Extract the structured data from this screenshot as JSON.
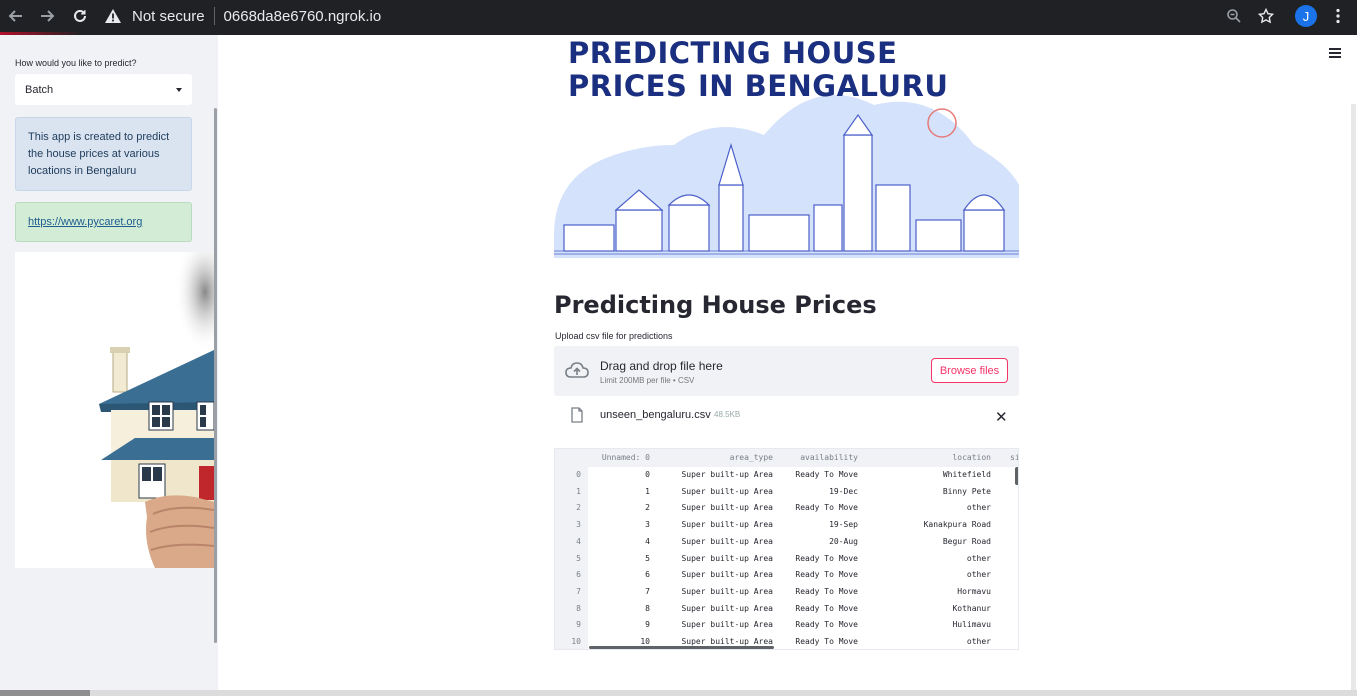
{
  "browser": {
    "security_label": "Not secure",
    "url": "0668da8e6760.ngrok.io",
    "profile_initial": "J"
  },
  "sidebar": {
    "predict_label": "How would you like to predict?",
    "predict_value": "Batch",
    "info_text": "This app is created to predict the house prices at various locations in Bengaluru",
    "link_text": "https://www.pycaret.org"
  },
  "banner": {
    "line1": "PREDICTING HOUSE",
    "line2": "PRICES IN BENGALURU"
  },
  "main": {
    "title": "Predicting House Prices",
    "upload_label": "Upload csv file for predictions",
    "dropzone_title": "Drag and drop file here",
    "dropzone_sub": "Limit 200MB per file • CSV",
    "browse_label": "Browse files",
    "file_name": "unseen_bengaluru.csv",
    "file_size": "48.5KB"
  },
  "table": {
    "columns": [
      "Unnamed: 0",
      "area_type",
      "availability",
      "location",
      "si"
    ],
    "rows": [
      [
        "0",
        "0",
        "Super built-up Area",
        "Ready To Move",
        "Whitefield"
      ],
      [
        "1",
        "1",
        "Super built-up Area",
        "19-Dec",
        "Binny Pete"
      ],
      [
        "2",
        "2",
        "Super built-up Area",
        "Ready To Move",
        "other"
      ],
      [
        "3",
        "3",
        "Super built-up Area",
        "19-Sep",
        "Kanakpura Road"
      ],
      [
        "4",
        "4",
        "Super built-up Area",
        "20-Aug",
        "Begur Road"
      ],
      [
        "5",
        "5",
        "Super built-up Area",
        "Ready To Move",
        "other"
      ],
      [
        "6",
        "6",
        "Super built-up Area",
        "Ready To Move",
        "other"
      ],
      [
        "7",
        "7",
        "Super built-up Area",
        "Ready To Move",
        "Hormavu"
      ],
      [
        "8",
        "8",
        "Super built-up Area",
        "Ready To Move",
        "Kothanur"
      ],
      [
        "9",
        "9",
        "Super built-up Area",
        "Ready To Move",
        "Hulimavu"
      ],
      [
        "10",
        "10",
        "Super built-up Area",
        "Ready To Move",
        "other"
      ]
    ]
  }
}
